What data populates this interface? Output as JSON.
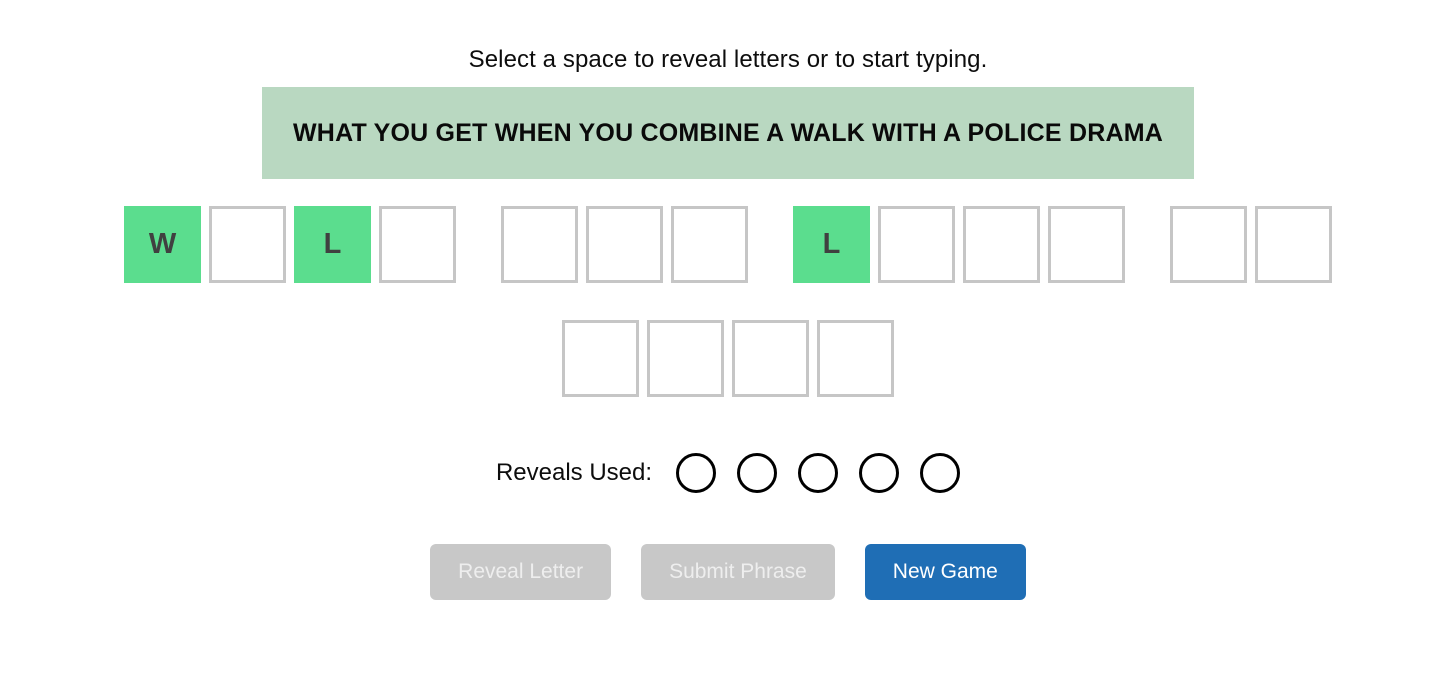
{
  "instruction": "Select a space to reveal letters or to start typing.",
  "clue": {
    "text": "WHAT YOU GET WHEN YOU COMBINE A WALK WITH A POLICE DRAMA",
    "background_color": "#b9d8c1"
  },
  "board": {
    "revealed_tile_color": "#5bdd8e",
    "empty_tile_border_color": "#c6c6c6",
    "rows": [
      {
        "words": [
          {
            "letters": [
              "W",
              "",
              "L",
              ""
            ]
          },
          {
            "letters": [
              "",
              "",
              ""
            ]
          },
          {
            "letters": [
              "L",
              "",
              "",
              ""
            ]
          },
          {
            "letters": [
              "",
              ""
            ]
          }
        ]
      },
      {
        "words": [
          {
            "letters": [
              "",
              "",
              "",
              ""
            ]
          }
        ]
      }
    ]
  },
  "reveals": {
    "label": "Reveals Used:",
    "total": 5,
    "used": 0,
    "pips": [
      false,
      false,
      false,
      false,
      false
    ]
  },
  "actions": {
    "buttons": [
      {
        "label": "Reveal Letter",
        "state": "disabled",
        "color": "#c8c8c8"
      },
      {
        "label": "Submit Phrase",
        "state": "disabled",
        "color": "#c8c8c8"
      },
      {
        "label": "New Game",
        "state": "enabled",
        "color": "#1f6eb5"
      }
    ]
  }
}
